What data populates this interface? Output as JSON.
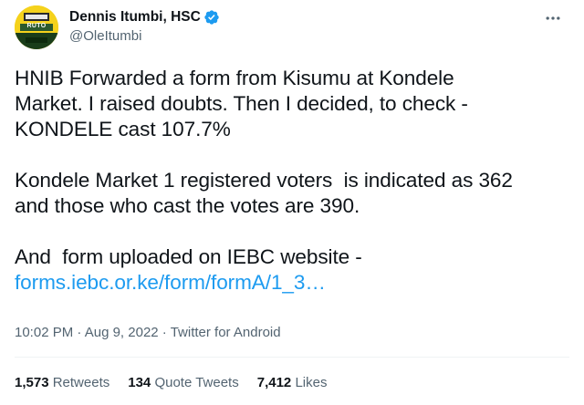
{
  "author": {
    "display_name": "Dennis Itumbi, HSC",
    "handle": "@OleItumbi",
    "verified": true,
    "avatar_text": "RUTO"
  },
  "tweet": {
    "paragraphs": [
      [
        "HNIB Forwarded a form from Kisumu at Kondele",
        "Market. I raised doubts. Then I decided, to check -",
        "KONDELE cast 107.7%"
      ],
      [
        "Kondele Market 1 registered voters  is indicated as 362",
        "and those who cast the votes are 390."
      ],
      [
        "And  form uploaded on IEBC website -"
      ]
    ],
    "link_text": "forms.iebc.or.ke/form/formA/1_3…"
  },
  "meta": {
    "time": "10:02 PM",
    "date": "Aug 9, 2022",
    "source": "Twitter for Android",
    "separator": " · "
  },
  "stats": {
    "retweets_count": "1,573",
    "retweets_label": " Retweets",
    "quotes_count": "134",
    "quotes_label": " Quote Tweets",
    "likes_count": "7,412",
    "likes_label": " Likes"
  },
  "colors": {
    "link": "#1d9bf0",
    "verified": "#1d9bf0",
    "secondary_text": "#536471",
    "primary_text": "#0f1419"
  },
  "icons": {
    "verified": "verified-badge-icon",
    "more": "more-options-icon"
  }
}
